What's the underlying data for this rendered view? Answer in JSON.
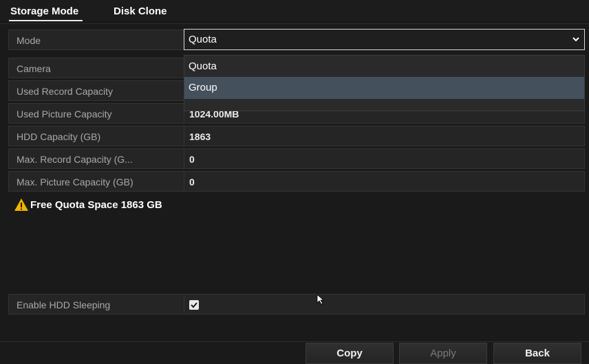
{
  "tabs": [
    {
      "label": "Storage Mode",
      "active": true
    },
    {
      "label": "Disk Clone",
      "active": false
    }
  ],
  "mode": {
    "label": "Mode",
    "selected": "Quota",
    "options": [
      "Quota",
      "Group"
    ],
    "highlighted_option": "Group"
  },
  "fields": {
    "camera": {
      "label": "Camera",
      "value": ""
    },
    "used_record": {
      "label": "Used Record Capacity",
      "value": ""
    },
    "used_picture": {
      "label": "Used Picture Capacity",
      "value": "1024.00MB"
    },
    "hdd_capacity": {
      "label": "HDD Capacity (GB)",
      "value": "1863"
    },
    "max_record": {
      "label": "Max. Record Capacity (G...",
      "value": "0"
    },
    "max_picture": {
      "label": "Max. Picture Capacity (GB)",
      "value": "0"
    }
  },
  "warning": {
    "text": "Free Quota Space 1863 GB",
    "icon": "warning-triangle-icon",
    "color": "#f0b400"
  },
  "hdd_sleeping": {
    "label": "Enable HDD Sleeping",
    "checked": true
  },
  "buttons": {
    "copy": "Copy",
    "apply": "Apply",
    "back": "Back"
  }
}
